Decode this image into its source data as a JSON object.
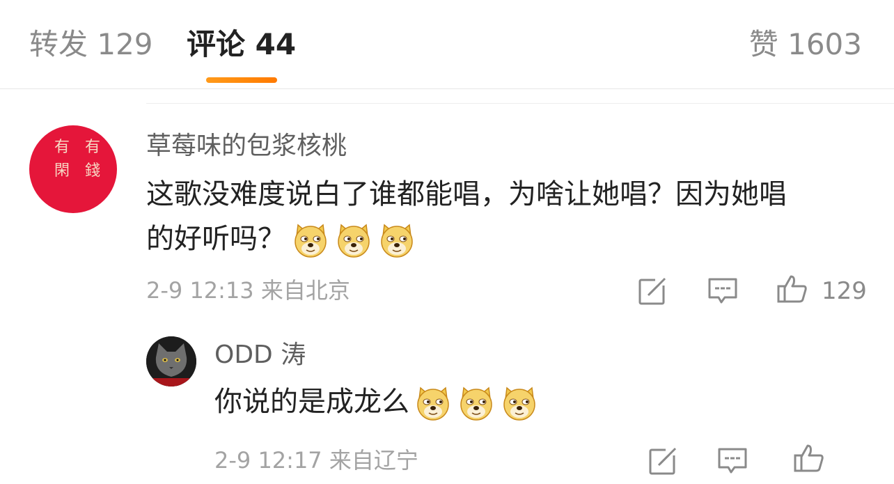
{
  "tabs": {
    "repost": "转发 129",
    "comments": "评论 44",
    "likes": "赞 1603",
    "active_color": "#ff8200"
  },
  "comment": {
    "avatar_seal": [
      "有",
      "有",
      "閑",
      "錢"
    ],
    "username": "草莓味的包浆核桃",
    "text_line1": "这歌没难度说白了谁都能唱，为啥让她唱？因为她唱",
    "text_line2": "的好听吗？",
    "emoji": [
      "doge-emoji",
      "doge-emoji",
      "doge-emoji"
    ],
    "time": "2-9 12:13",
    "location": "来自北京",
    "like_count": "129"
  },
  "reply": {
    "username": "ODD 涛",
    "text": "你说的是成龙么",
    "emoji": [
      "doge-emoji",
      "doge-emoji",
      "doge-emoji"
    ],
    "time": "2-9 12:17",
    "location": "来自辽宁"
  },
  "icons": [
    "share-icon",
    "reply-icon",
    "like-icon"
  ]
}
